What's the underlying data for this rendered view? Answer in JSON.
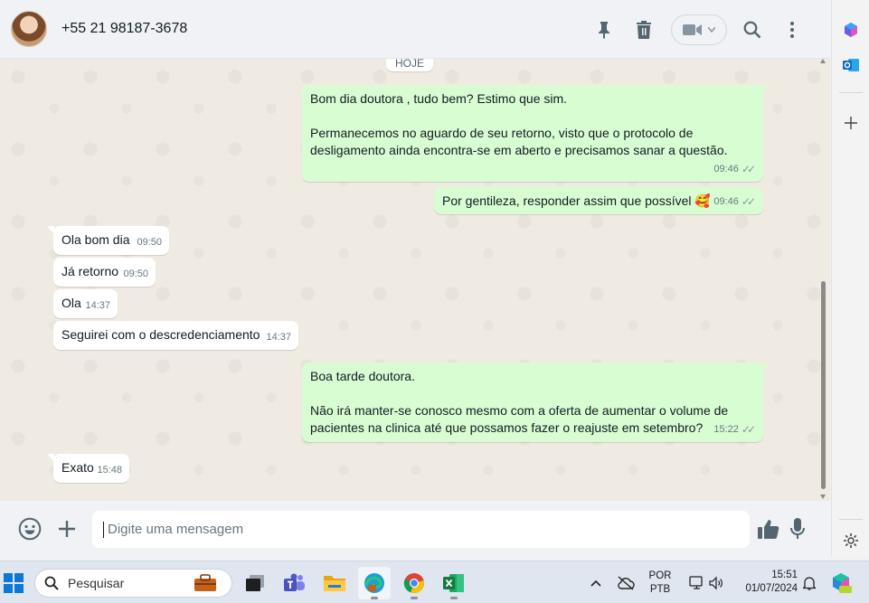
{
  "chat_header": {
    "contact_name": "+55 21 98187-3678",
    "icons": [
      "pin-icon",
      "delete-icon",
      "video-call-icon",
      "search-icon",
      "menu-icon"
    ]
  },
  "date_chip": "HOJE",
  "messages": [
    {
      "dir": "out",
      "text": "Bom dia doutora , tudo bem? Estimo que sim.\n\nPermanecemos no aguardo de seu retorno, visto que o protocolo de\ndesligamento ainda encontra-se em aberto e precisamos sanar a questão.",
      "time": "09:46",
      "status": "read"
    },
    {
      "dir": "out",
      "text": "Por gentileza, responder assim que possível 🥰",
      "time": "09:46",
      "status": "read"
    },
    {
      "dir": "in",
      "text": "Ola bom dia",
      "time": "09:50"
    },
    {
      "dir": "in",
      "text": "Já retorno",
      "time": "09:50"
    },
    {
      "dir": "in",
      "text": "Ola",
      "time": "14:37"
    },
    {
      "dir": "in",
      "text": "Seguirei com o descredenciamento",
      "time": "14:37"
    },
    {
      "dir": "out",
      "text": "Boa tarde doutora.\n\nNão irá manter-se conosco mesmo com a oferta de aumentar o volume de\npacientes na clinica até que possamos fazer o reajuste em setembro?",
      "time": "15:22",
      "status": "read"
    },
    {
      "dir": "in",
      "text": "Exato",
      "time": "15:48"
    }
  ],
  "composer": {
    "placeholder": "Digite uma mensagem",
    "icons": [
      "emoji-icon",
      "attach-plus-icon",
      "thumbs-up-icon",
      "microphone-icon"
    ]
  },
  "side_rail": {
    "icons": [
      "copilot-icon",
      "outlook-icon",
      "add-icon",
      "settings-icon"
    ]
  },
  "taskbar": {
    "search_placeholder": "Pesquisar",
    "apps": [
      "start-icon",
      "widgets-icon",
      "task-view-icon",
      "teams-icon",
      "file-explorer-icon",
      "edge-icon",
      "chrome-icon",
      "excel-icon"
    ],
    "language_line1": "POR",
    "language_line2": "PTB",
    "time": "15:51",
    "date": "01/07/2024"
  },
  "colors": {
    "outgoing_bubble": "#d9fdd3",
    "incoming_bubble": "#ffffff",
    "chat_background": "#efeae2",
    "header_background": "#f0f2f5"
  }
}
